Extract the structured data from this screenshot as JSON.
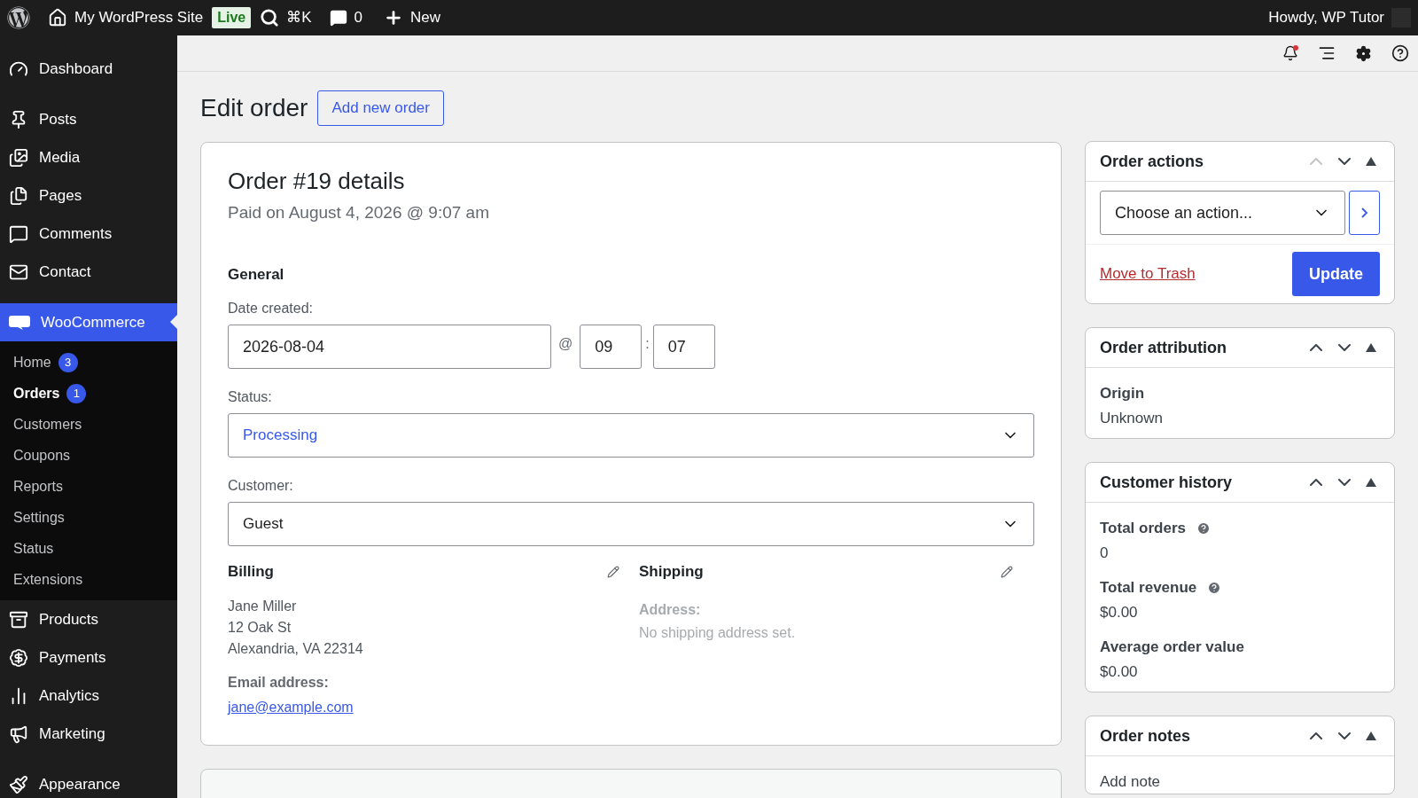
{
  "top_bar": {
    "site_name": "My WordPress Site",
    "live_badge": "Live",
    "search_shortcut": "⌘K",
    "comments_count": "0",
    "new_label": "New",
    "greeting": "Howdy, WP Tutor"
  },
  "sidebar": {
    "items": [
      {
        "label": "Dashboard",
        "selected": false
      },
      {
        "label": "Posts",
        "selected": false
      },
      {
        "label": "Media",
        "selected": false
      },
      {
        "label": "Pages",
        "selected": false
      },
      {
        "label": "Comments",
        "selected": false
      },
      {
        "label": "Contact",
        "selected": false
      },
      {
        "label": "WooCommerce",
        "selected": true,
        "children": [
          {
            "label": "Home",
            "selected": false,
            "badge": "3"
          },
          {
            "label": "Orders",
            "selected": true,
            "badge": "1"
          },
          {
            "label": "Customers",
            "selected": false
          },
          {
            "label": "Coupons",
            "selected": false
          },
          {
            "label": "Reports",
            "selected": false
          },
          {
            "label": "Settings",
            "selected": false
          },
          {
            "label": "Status",
            "selected": false
          },
          {
            "label": "Extensions",
            "selected": false
          }
        ]
      },
      {
        "label": "Products",
        "selected": false
      },
      {
        "label": "Payments",
        "selected": false
      },
      {
        "label": "Analytics",
        "selected": false
      },
      {
        "label": "Marketing",
        "selected": false
      },
      {
        "label": "Appearance",
        "selected": false
      }
    ]
  },
  "toolbar": {
    "notification_unread": true
  },
  "page": {
    "title": "Edit order",
    "add_button": "Add new order"
  },
  "order": {
    "heading": "Order #19 details",
    "subheading": "Paid on August 4, 2026 @ 9:07 am",
    "general_title": "General",
    "date_label": "Date created:",
    "date": "2026-08-04",
    "at_sign": "@",
    "hour": "09",
    "time_separator": ":",
    "minute": "07",
    "status_label": "Status:",
    "status": "Processing",
    "customer_label": "Customer:",
    "customer": "Guest",
    "billing": {
      "title": "Billing",
      "lines": [
        "Jane Miller",
        "12 Oak St",
        "Alexandria, VA 22314"
      ],
      "email_label": "Email address:",
      "email": "jane@example.com"
    },
    "shipping": {
      "title": "Shipping",
      "address_label": "Address:",
      "address": "No shipping address set."
    }
  },
  "side_panels": [
    {
      "kind": "actions",
      "title": "Order actions",
      "up_disabled": true,
      "select": "Choose an action...",
      "trash": "Move to Trash",
      "update": "Update"
    },
    {
      "kind": "fields",
      "title": "Order attribution",
      "up_disabled": false,
      "fields": [
        {
          "label": "Origin",
          "value": "Unknown",
          "help": false
        }
      ]
    },
    {
      "kind": "fields",
      "title": "Customer history",
      "up_disabled": false,
      "fields": [
        {
          "label": "Total orders",
          "value": "0",
          "help": true
        },
        {
          "label": "Total revenue",
          "value": "$0.00",
          "help": true
        },
        {
          "label": "Average order value",
          "value": "$0.00",
          "help": false
        }
      ]
    },
    {
      "kind": "notes",
      "title": "Order notes",
      "up_disabled": false,
      "note_label": "Add note"
    }
  ]
}
